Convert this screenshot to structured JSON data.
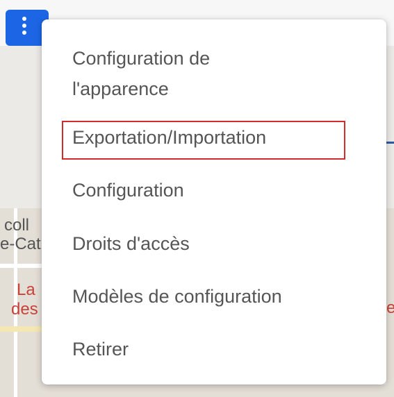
{
  "menu": {
    "items": [
      {
        "id": "appearance",
        "label_line1": "Configuration de",
        "label_line2": "l'apparence"
      },
      {
        "id": "export",
        "label": "Exportation/Importation",
        "highlighted": true
      },
      {
        "id": "configuration",
        "label": "Configuration"
      },
      {
        "id": "access",
        "label": "Droits d'accès"
      },
      {
        "id": "templates",
        "label": "Modèles de configuration"
      },
      {
        "id": "remove",
        "label": "Retirer"
      }
    ]
  },
  "map": {
    "labels": [
      {
        "text": "coll"
      },
      {
        "text": "e-Cat"
      },
      {
        "text": "La"
      },
      {
        "text": "des"
      },
      {
        "text": "e"
      }
    ]
  },
  "colors": {
    "kebab_button": "#1c66e5",
    "highlight_border": "#d02a2a",
    "menu_text": "#555555",
    "connector_line": "#2c5aa0"
  },
  "icons": {
    "kebab": "vertical-ellipsis-icon"
  }
}
